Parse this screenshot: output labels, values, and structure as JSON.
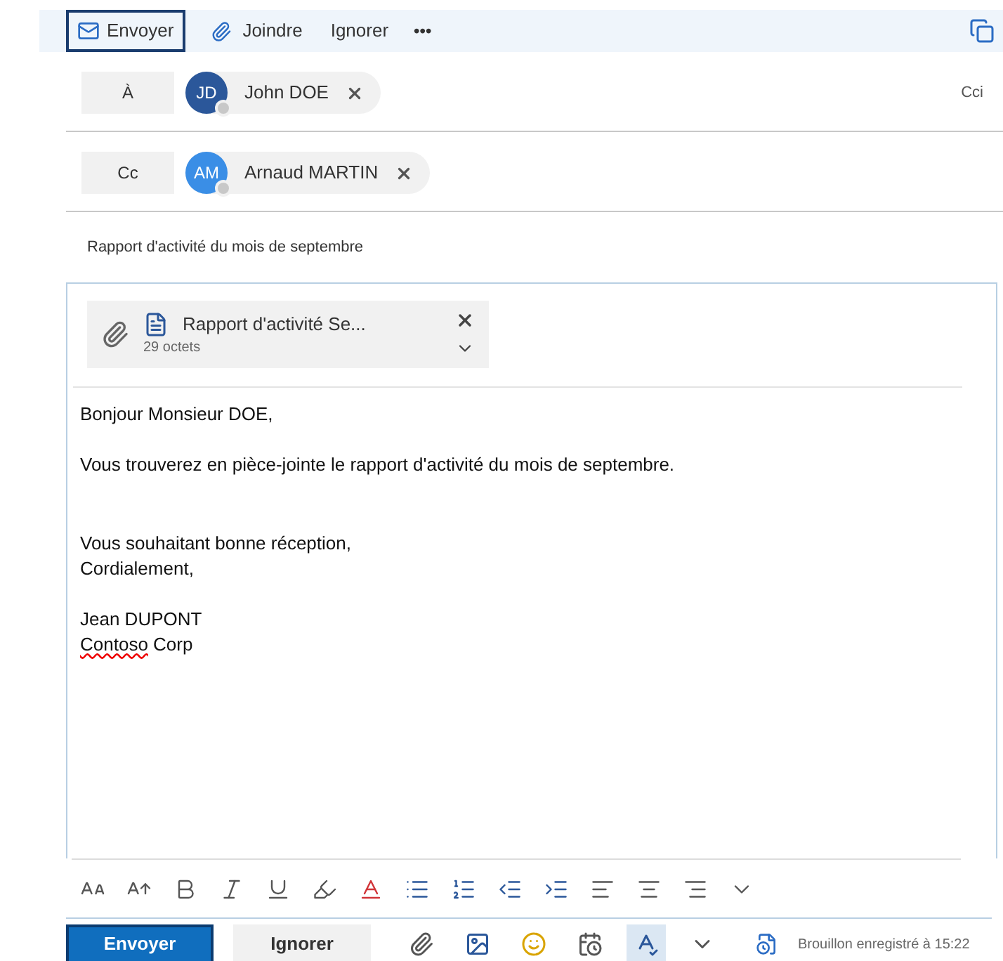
{
  "toolbar": {
    "send": "Envoyer",
    "attach": "Joindre",
    "discard": "Ignorer",
    "more": "•••"
  },
  "recipients": [
    {
      "label": "À",
      "chips": [
        {
          "initials": "JD",
          "name": "John DOE",
          "color": "#2b579a"
        }
      ],
      "extra": "Cci"
    },
    {
      "label": "Cc",
      "chips": [
        {
          "initials": "AM",
          "name": "Arnaud MARTIN",
          "color": "#3a8ee6"
        }
      ]
    }
  ],
  "subject": "Rapport d'activité du mois de septembre",
  "attachment": {
    "name": "Rapport d'activité Se...",
    "size": "29 octets"
  },
  "body": [
    {
      "kind": "paragraph",
      "lines": [
        [
          {
            "text": "Bonjour Monsieur DOE,",
            "misspelled": false
          }
        ]
      ]
    },
    {
      "kind": "paragraph",
      "lines": [
        [
          {
            "text": "Vous trouverez en pièce-jointe le rapport d'activité du mois de septembre.",
            "misspelled": false
          }
        ]
      ]
    },
    {
      "kind": "blank"
    },
    {
      "kind": "paragraph",
      "lines": [
        [
          {
            "text": "Vous souhaitant bonne réception,",
            "misspelled": false
          }
        ],
        [
          {
            "text": "Cordialement,",
            "misspelled": false
          }
        ]
      ]
    },
    {
      "kind": "paragraph",
      "lines": [
        [
          {
            "text": "Jean DUPONT",
            "misspelled": false
          }
        ],
        [
          {
            "text": "Contoso",
            "misspelled": true
          },
          {
            "text": " Corp",
            "misspelled": false
          }
        ]
      ]
    }
  ],
  "format_tools": [
    {
      "kind": "font-size"
    },
    {
      "kind": "grow"
    },
    {
      "kind": "bold"
    },
    {
      "kind": "italic"
    },
    {
      "kind": "underline"
    },
    {
      "kind": "highlight"
    },
    {
      "kind": "font-color"
    },
    {
      "kind": "bullets"
    },
    {
      "kind": "numbering"
    },
    {
      "kind": "outdent"
    },
    {
      "kind": "indent"
    },
    {
      "kind": "align-left"
    },
    {
      "kind": "align-center"
    },
    {
      "kind": "align-right"
    },
    {
      "kind": "more"
    }
  ],
  "footer": {
    "send": "Envoyer",
    "discard": "Ignorer",
    "tools": [
      {
        "kind": "attach",
        "selected": false
      },
      {
        "kind": "image",
        "selected": false
      },
      {
        "kind": "emoji",
        "selected": false
      },
      {
        "kind": "schedule",
        "selected": false
      },
      {
        "kind": "spelling",
        "selected": true
      },
      {
        "kind": "more",
        "selected": false
      }
    ],
    "status": "Brouillon enregistré à 15:22"
  }
}
